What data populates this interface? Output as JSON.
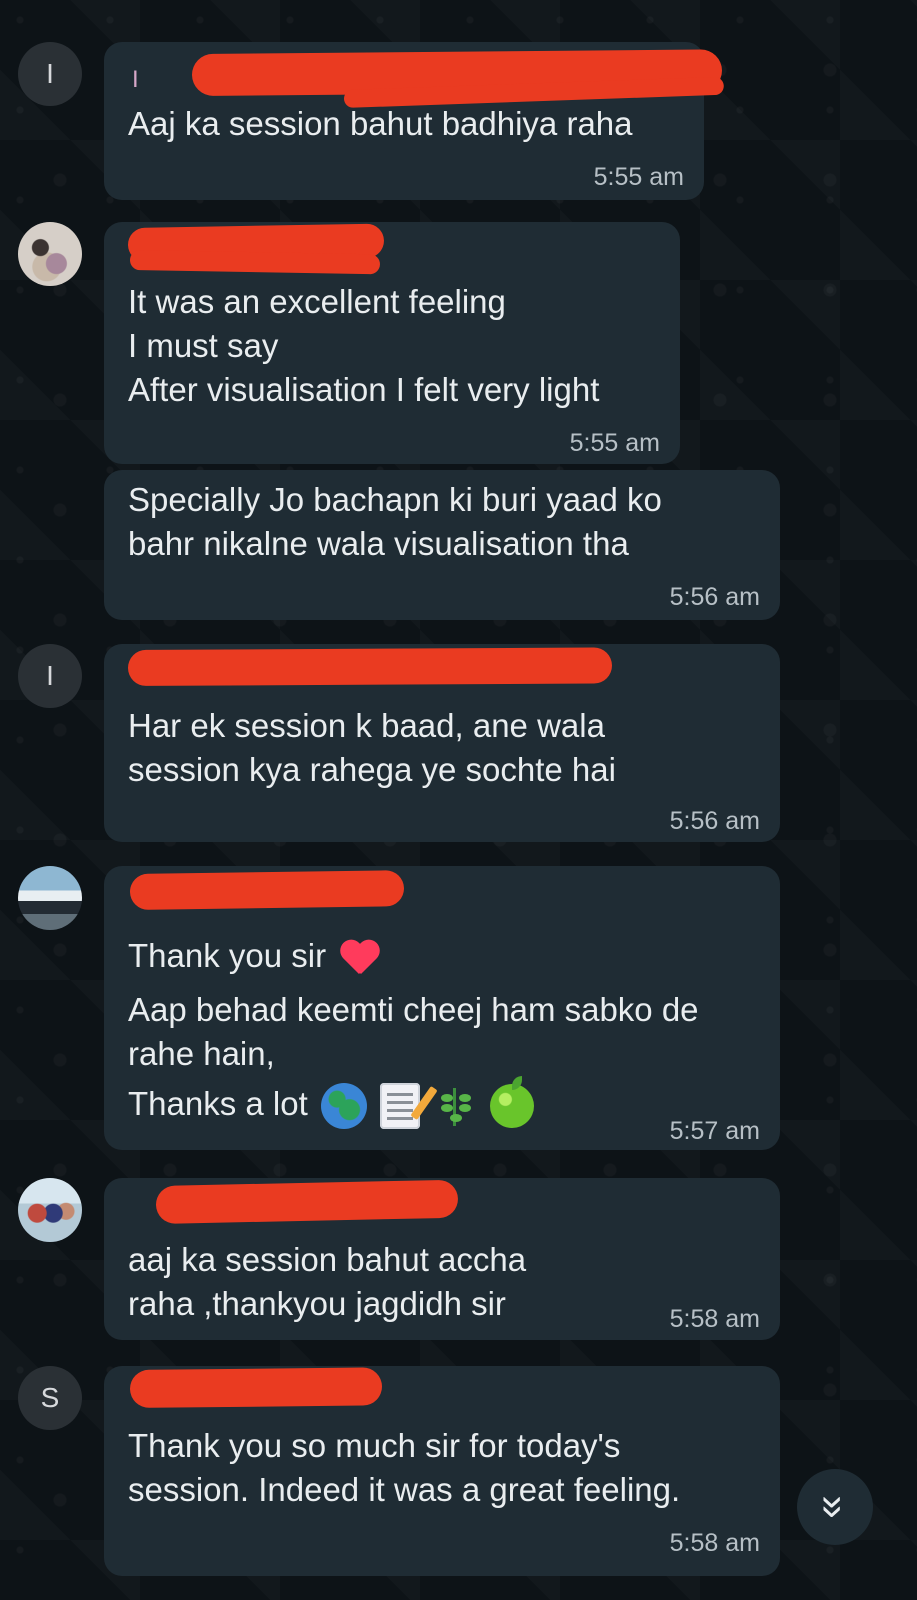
{
  "messages": [
    {
      "avatar": "I",
      "sender": "I",
      "lines": [
        "Aaj ka session bahut badhiya raha"
      ],
      "time": "5:55 am"
    },
    {
      "avatar": "",
      "sender": "",
      "lines": [
        "It was an excellent feeling",
        "I must say",
        "After visualisation I felt very light"
      ],
      "time": "5:55 am"
    },
    {
      "lines": [
        "Specially Jo bachapn ki buri yaad ko",
        "bahr nikalne wala visualisation tha"
      ],
      "time": "5:56 am"
    },
    {
      "avatar": "I",
      "sender": "",
      "lines": [
        "Har ek session k baad, ane wala",
        "session kya rahega ye sochte hai"
      ],
      "time": "5:56 am"
    },
    {
      "avatar": "",
      "sender": "",
      "lines": [
        "Thank you sir",
        "Aap behad keemti cheej ham sabko de",
        "rahe hain,",
        "Thanks a lot"
      ],
      "time": "5:57 am"
    },
    {
      "avatar": "",
      "sender": "",
      "lines": [
        "aaj ka session bahut accha",
        "raha ,thankyou jagdidh sir"
      ],
      "time": "5:58 am"
    },
    {
      "avatar": "S",
      "sender": "",
      "lines": [
        "Thank you so much sir for today's",
        "session. Indeed it was a great feeling."
      ],
      "time": "5:58 am"
    }
  ],
  "icons": {
    "heart": "heart-icon",
    "globe": "globe-icon",
    "memo": "memo-icon",
    "herb": "herb-icon",
    "apple": "green-apple-icon",
    "scroll": "double-chevron-down-icon"
  },
  "colors": {
    "background": "#0d1317",
    "bubble": "#1f2c34",
    "text": "#e9edef",
    "time": "#b7c0c6",
    "redaction": "#ea3b21"
  },
  "scroll_button_label": "»"
}
